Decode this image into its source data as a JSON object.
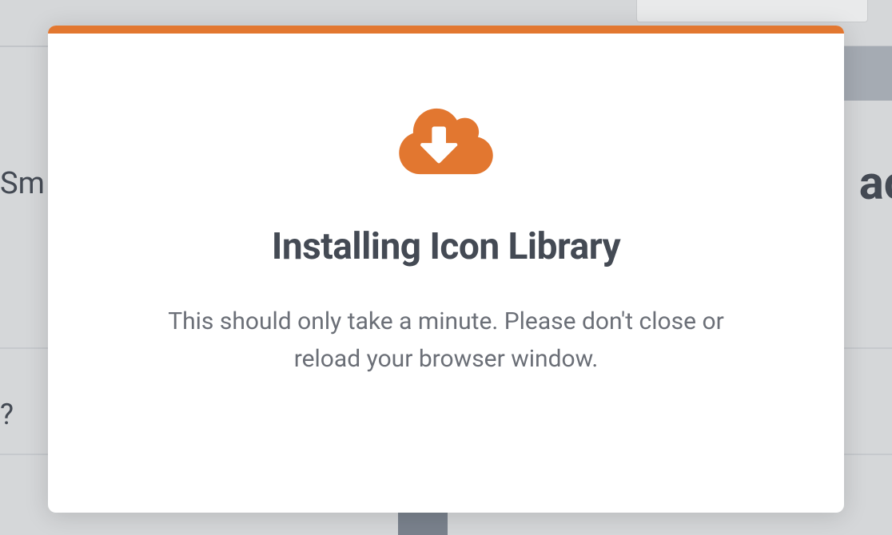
{
  "background": {
    "left_text": "Sm",
    "right_text": "ac",
    "question_text": "?"
  },
  "modal": {
    "icon_name": "cloud-download-icon",
    "title": "Installing Icon Library",
    "description": "This should only take a minute. Please don't close or reload your browser window.",
    "accent_color": "#e27730"
  }
}
